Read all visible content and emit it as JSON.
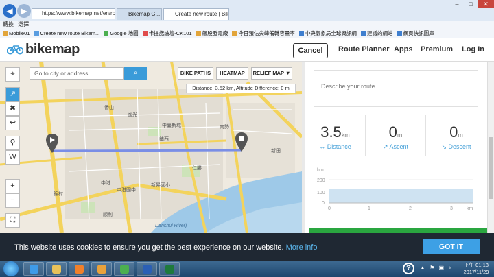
{
  "browser": {
    "address": "https://www.bikemap.net/en/ro",
    "tabs": [
      "Bikemap G...",
      "Create new route | Bikema..."
    ],
    "window_controls": [
      "–",
      "□",
      "✕"
    ],
    "menu": [
      "轉換",
      "選擇"
    ],
    "favorites": [
      "Mobile01",
      "Create new route  Bikem...",
      "Google 地圖",
      "卡提諾論壇-CK101",
      "飆股發電廠",
      "今日預估尖峰備轉容量率",
      "中央氣象局全球資訊網",
      "建議的網站",
      "網頁快訊圖庫"
    ]
  },
  "header": {
    "logo": "bikemap",
    "cancel_label": "Cancel",
    "nav": [
      "Route Planner",
      "Apps",
      "Premium",
      "Log In"
    ]
  },
  "map": {
    "search_placeholder": "Go to city or address",
    "toggles": [
      "BIKE PATHS",
      "HEATMAP",
      "RELIEF MAP ▼"
    ],
    "distance_info": "Distance: 3.52 km, Altitude Difference: 0 m",
    "tools": [
      "⌖",
      "↗",
      "✖",
      "↩",
      "⚲",
      "W",
      "+",
      "−",
      "⛶"
    ],
    "labels": [
      "香山",
      "中臺新城",
      "國光",
      "鎮西",
      "中港",
      "中港國中",
      "順利",
      "仁勝",
      "新昇國小",
      "錦村",
      "南勢",
      "新田"
    ],
    "river_label": "Danshui River)"
  },
  "panel": {
    "describe_placeholder": "Describe your route",
    "stats": [
      {
        "value": "3.5",
        "unit": "km",
        "label": "Distance",
        "icon": "↔"
      },
      {
        "value": "0",
        "unit": "m",
        "label": "Ascent",
        "icon": "↗"
      },
      {
        "value": "0",
        "unit": "m",
        "label": "Descent",
        "icon": "↘"
      }
    ],
    "profile": {
      "y_unit": "hm",
      "y_ticks": [
        "200",
        "100",
        "0"
      ],
      "x_ticks": [
        "0",
        "1",
        "2",
        "3"
      ],
      "x_unit": "km"
    }
  },
  "cookie": {
    "text": "This website uses cookies to ensure you get the best experience on our website.",
    "more": "More info",
    "button": "GOT IT"
  },
  "taskbar": {
    "time": "下午 01:18",
    "date": "2017/11/29",
    "help": "?"
  }
}
